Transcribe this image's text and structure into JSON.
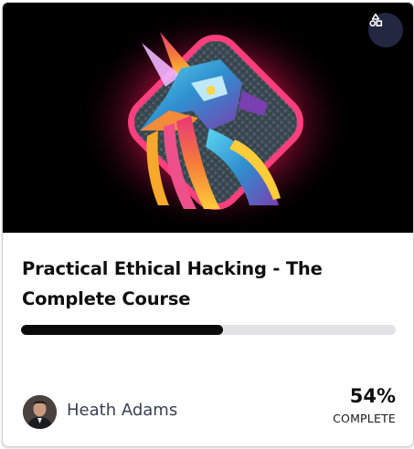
{
  "course": {
    "title": "Practical Ethical Hacking - The Complete Course",
    "progress_percent": 54,
    "progress_text": "54%",
    "progress_label": "COMPLETE",
    "author": "Heath Adams",
    "type_icon": "shapes-icon"
  },
  "colors": {
    "hero_background": "#000000",
    "progress_fill": "#0a0a0a",
    "progress_track": "#e3e3e6",
    "badge_background": "#242741",
    "glow": "#ff2a6d",
    "accent_cyan": "#35b8e0",
    "accent_magenta": "#d1267d",
    "accent_orange": "#f7a92c"
  }
}
